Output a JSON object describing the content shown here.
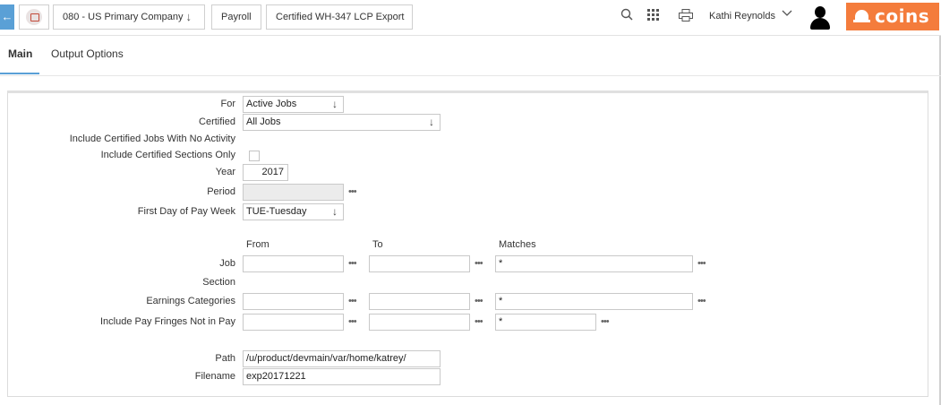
{
  "header": {
    "company": "080 - US Primary Company",
    "module": "Payroll",
    "page": "Certified WH-347 LCP Export",
    "user_name": "Kathi Reynolds",
    "logo_text": "coins",
    "icons": [
      "back-arrow-icon",
      "printer-icon",
      "chevron-down-icon",
      "search-icon",
      "grid-icon",
      "print-icon",
      "avatar-icon",
      "hardhat-icon"
    ]
  },
  "tabs": [
    {
      "label": "Main",
      "active": true
    },
    {
      "label": "Output Options",
      "active": false
    }
  ],
  "form": {
    "for": {
      "label": "For",
      "value": "Active Jobs"
    },
    "certified": {
      "label": "Certified",
      "value": "All Jobs"
    },
    "no_activity": {
      "label": "Include Certified Jobs With No Activity"
    },
    "sections_only": {
      "label": "Include Certified Sections Only",
      "checked": false
    },
    "year": {
      "label": "Year",
      "value": "2017"
    },
    "period": {
      "label": "Period",
      "value": ""
    },
    "first_day": {
      "label": "First Day of Pay Week",
      "value": "TUE-Tuesday"
    },
    "columns": {
      "from": "From",
      "to": "To",
      "matches": "Matches"
    },
    "job": {
      "label": "Job",
      "from": "",
      "to": "",
      "matches": "*"
    },
    "section": {
      "label": "Section"
    },
    "earnings": {
      "label": "Earnings Categories",
      "from": "",
      "to": "",
      "matches": "*"
    },
    "pay_fringes": {
      "label": "Include Pay Fringes Not in Pay",
      "from": "",
      "to": "",
      "matches": "*"
    },
    "path": {
      "label": "Path",
      "value": "/u/product/devmain/var/home/katrey/"
    },
    "filename": {
      "label": "Filename",
      "value": "exp20171221"
    },
    "lookup_glyph": "•••"
  },
  "colors": {
    "accent": "#5aa0d6",
    "logo": "#f47c3c",
    "highlight": "#ffff33"
  }
}
